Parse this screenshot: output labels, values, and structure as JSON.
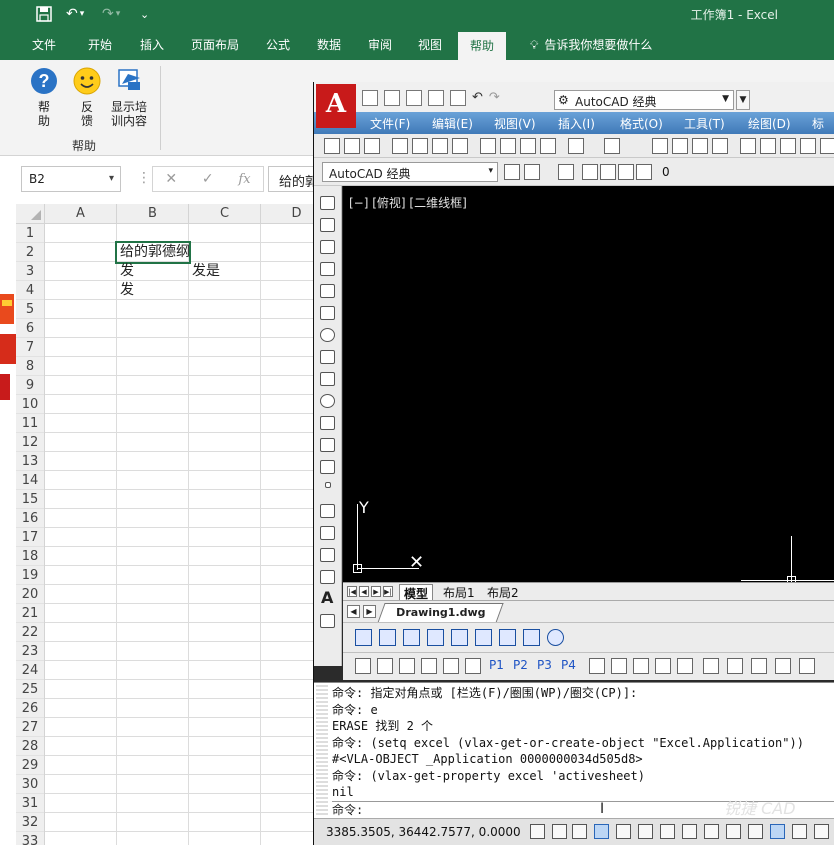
{
  "excel": {
    "title": "工作簿1  -  Excel",
    "tabs": [
      "文件",
      "开始",
      "插入",
      "页面布局",
      "公式",
      "数据",
      "审阅",
      "视图",
      "帮助"
    ],
    "active_tab": "帮助",
    "tell_me": "告诉我你想要做什么",
    "ribbon": {
      "buttons": [
        {
          "label": "帮\n助",
          "icon": "help-icon"
        },
        {
          "label": "反\n馈",
          "icon": "smiley-icon"
        },
        {
          "label": "显示培\n训内容",
          "icon": "training-icon"
        }
      ],
      "group_label": "帮助"
    },
    "name_box": "B2",
    "formula": "给的郭",
    "columns": [
      "A",
      "B",
      "C",
      "D"
    ],
    "rows": [
      "1",
      "2",
      "3",
      "4",
      "5",
      "6",
      "7",
      "8",
      "9",
      "10",
      "11",
      "12",
      "13",
      "14",
      "15",
      "16",
      "17",
      "18",
      "19",
      "20",
      "21",
      "22",
      "23",
      "24",
      "25",
      "26",
      "27",
      "28",
      "29",
      "30",
      "31",
      "32",
      "33"
    ],
    "cells": {
      "B2": "给的郭德纲",
      "B3": "发",
      "C3": "发是",
      "B4": "发"
    }
  },
  "autocad": {
    "workspace": "AutoCAD 经典",
    "workspace2": "AutoCAD 经典",
    "layer_value": "0",
    "menus": [
      "文件(F)",
      "编辑(E)",
      "视图(V)",
      "插入(I)",
      "格式(O)",
      "工具(T)",
      "绘图(D)",
      "标注"
    ],
    "viewport_label": "[−] [俯视] [二维线框]",
    "layout_tabs": [
      "模型",
      "布局1",
      "布局2"
    ],
    "active_layout": "模型",
    "file_tab": "Drawing1.dwg",
    "plot_buttons": [
      "P1",
      "P2",
      "P3",
      "P4"
    ],
    "command_log": [
      "命令: 指定对角点或 [栏选(F)/圈围(WP)/圈交(CP)]:",
      "命令: e",
      "ERASE 找到 2 个",
      "命令: (setq excel (vlax-get-or-create-object \"Excel.Application\"))",
      "#<VLA-OBJECT _Application 0000000034d505d8>",
      "命令: (vlax-get-property excel 'activesheet)",
      "nil"
    ],
    "command_prompt": "命令:",
    "coordinates": "3385.3505,  36442.7577, 0.0000",
    "watermark": "锐捷 CAD"
  }
}
